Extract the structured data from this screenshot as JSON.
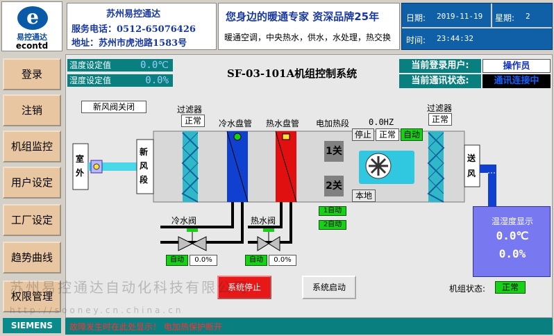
{
  "brand": {
    "logo_cn": "易控通达",
    "logo_en": "econtd",
    "siemens": "SIEMENS"
  },
  "sidebar": {
    "items": [
      {
        "label": "登录"
      },
      {
        "label": "注销"
      },
      {
        "label": "机组监控"
      },
      {
        "label": "用户设定"
      },
      {
        "label": "工厂设定"
      },
      {
        "label": "趋势曲线"
      },
      {
        "label": "权限管理"
      }
    ]
  },
  "header": {
    "company_name": "苏州易控通达",
    "phone": "服务电话：0512-65076426",
    "address": "地址：苏州市虎池路1583号",
    "slogan": "您身边的暖通专家 资深品牌25年",
    "services": "暖通空调，中央热水，供水，水处理，热交换",
    "date_label": "日期:",
    "date_value": "2019-11-19",
    "week_label": "星期:",
    "week_value": "2",
    "time_label": "时间:",
    "time_value": "23:44:32"
  },
  "setpoints": {
    "temp_label": "温度设定值",
    "temp_value": "0.0℃",
    "humidity_label": "湿度设定值",
    "humidity_value": "0.0%"
  },
  "title": "SF-03-101A机组控制系统",
  "status": {
    "user_label": "当前登录用户:",
    "user_value": "操作员",
    "comm_label": "当前通讯状态:",
    "comm_value": "通讯连接中"
  },
  "unit": {
    "fresh_valve": "新风阀关闭",
    "outdoor": "室外",
    "fresh_section": "新风段",
    "filter1_label": "过滤器",
    "filter1_status": "正常",
    "cold_coil": "冷水盘管",
    "hot_coil": "热水盘管",
    "heater_label": "电加热段",
    "freq": "0.0HZ",
    "fan_stop": "停止",
    "fan_normal": "正常",
    "fan_auto": "自动",
    "fan_local": "本地",
    "heater1": "1关",
    "heater2": "2关",
    "heater1_mode": "1自动",
    "heater2_mode": "2自动",
    "filter2_label": "过滤器",
    "filter2_status": "正常",
    "supply": "送风",
    "cold_valve": "冷水阀",
    "hot_valve": "热水阀",
    "cold_valve_mode": "自动",
    "cold_valve_open": "0.0%",
    "hot_valve_mode": "自动",
    "hot_valve_open": "0.0%"
  },
  "display": {
    "title": "温湿度显示",
    "temp": "0.0℃",
    "humidity": "0.0%"
  },
  "controls": {
    "stop_btn": "系统停止",
    "start_btn": "系统启动",
    "unit_state_label": "机组状态:",
    "unit_state_value": "正常"
  },
  "footer": {
    "message": "故障发生时在此处显示！   电加热保护断开"
  },
  "watermark": {
    "text": "苏州易控通达自动化科技有限公司",
    "url": "http://sooney.cn.china.cn"
  },
  "colors": {
    "teal": "#0a7f7f",
    "nav_button": "#e9c6a2",
    "cold": "#1040d0",
    "hot": "#e01010",
    "ok_green": "#18d018",
    "alarm_red": "#e81818"
  }
}
